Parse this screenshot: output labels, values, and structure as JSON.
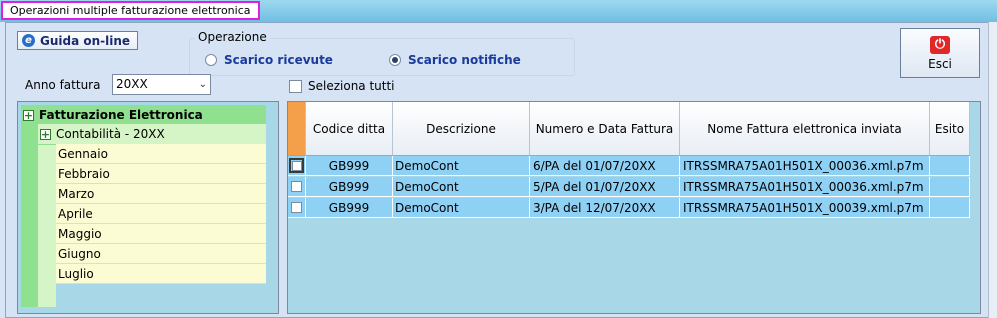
{
  "window": {
    "title": "Operazioni multiple fatturazione elettronica"
  },
  "toolbar": {
    "help_label": "Guida on-line",
    "exit_label": "Esci"
  },
  "operation": {
    "legend": "Operazione",
    "options": [
      {
        "label": "Scarico ricevute",
        "selected": false
      },
      {
        "label": "Scarico notifiche",
        "selected": true
      }
    ]
  },
  "filters": {
    "year_label": "Anno fattura",
    "year_value": "20XX",
    "select_all_label": "Seleziona tutti"
  },
  "tree": {
    "root": "Fatturazione Elettronica",
    "child": "Contabilità - 20XX",
    "months": [
      "Gennaio",
      "Febbraio",
      "Marzo",
      "Aprile",
      "Maggio",
      "Giugno",
      "Luglio"
    ]
  },
  "grid": {
    "columns": [
      "Codice ditta",
      "Descrizione",
      "Numero e Data Fattura",
      "Nome Fattura elettronica inviata",
      "Esito"
    ],
    "rows": [
      {
        "code": "GB999",
        "desc": "DemoCont",
        "number": "6/PA del 01/07/20XX",
        "file": "ITRSSMRA75A01H501X_00036.xml.p7m",
        "esito": ""
      },
      {
        "code": "GB999",
        "desc": "DemoCont",
        "number": "5/PA del 01/07/20XX",
        "file": "ITRSSMRA75A01H501X_00036.xml.p7m",
        "esito": ""
      },
      {
        "code": "GB999",
        "desc": "DemoCont",
        "number": "3/PA del 12/07/20XX",
        "file": "ITRSSMRA75A01H501X_00039.xml.p7m",
        "esito": ""
      }
    ]
  },
  "colors": {
    "accent": "#e020e0",
    "row_bg": "#8fd0f5",
    "tree_root": "#8fe08f",
    "month_bg": "#fcfcd4",
    "exit_icon": "#e02828"
  }
}
